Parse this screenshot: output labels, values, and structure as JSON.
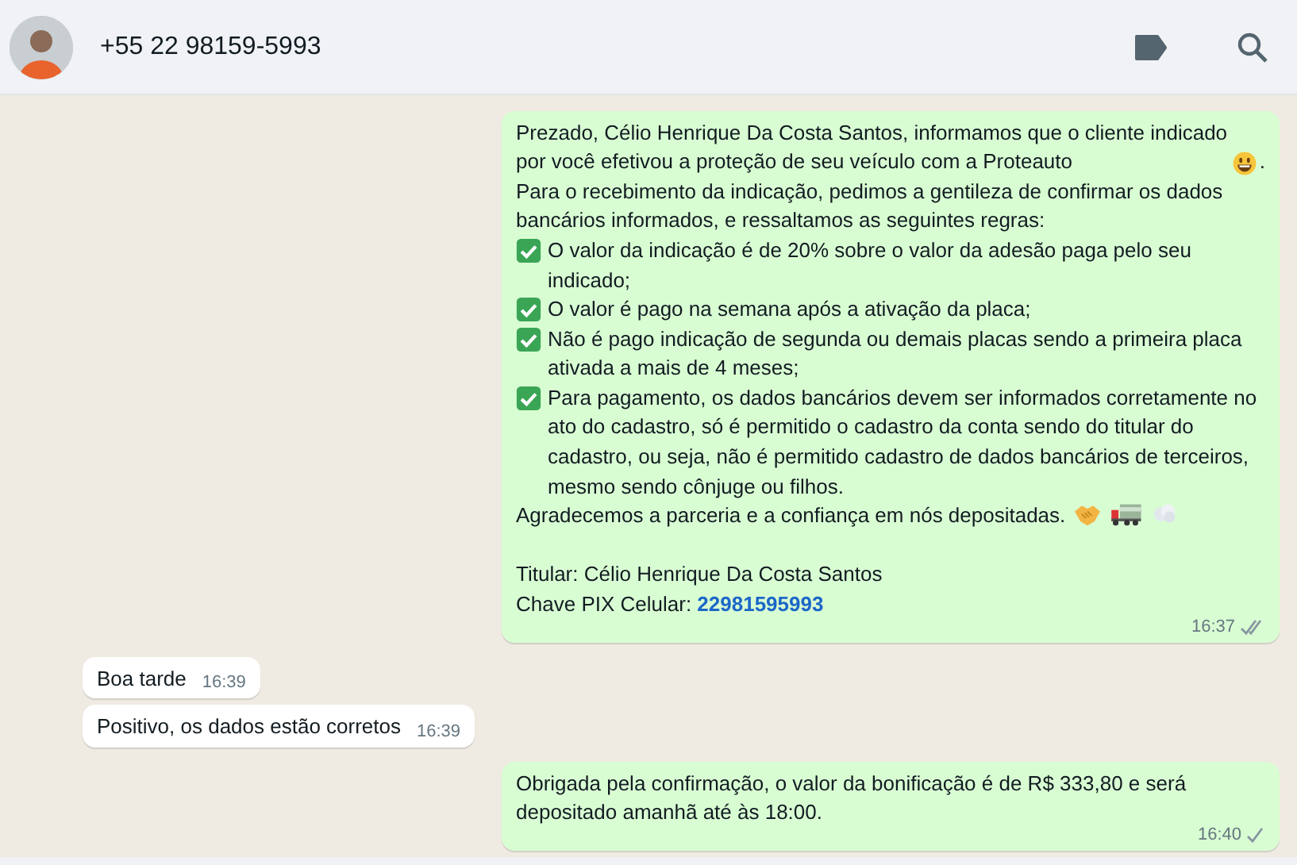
{
  "contact": {
    "name": "+55 22 98159-5993"
  },
  "messages": [
    {
      "kind": "out",
      "delivered": true,
      "time": "16:37",
      "paragraphs": [
        {
          "kind": "plain",
          "text": "Prezado, Célio Henrique Da Costa Santos, informamos que o cliente indicado por você efetivou a proteção de seu veículo com a Proteauto",
          "icons": [
            {
              "kind": "smiley"
            }
          ],
          "tail": "."
        },
        {
          "kind": "plain",
          "text": "Para o recebimento da indicação, pedimos a gentileza de confirmar os dados bancários informados, e  ressaltamos as seguintes regras:"
        },
        {
          "kind": "check",
          "text": "O valor da indicação é de 20% sobre o valor da adesão paga pelo seu indicado;"
        },
        {
          "kind": "check",
          "text": "O valor é pago na semana após a ativação da placa;"
        },
        {
          "kind": "check",
          "text": "Não é pago indicação de segunda ou demais placas sendo a primeira placa ativada a mais de 4 meses;"
        },
        {
          "kind": "check",
          "text": "Para pagamento, os dados bancários devem ser informados corretamente no ato do cadastro, só é permitido o cadastro da conta sendo do titular do cadastro, ou seja, não é permitido cadastro de dados bancários de terceiros, mesmo sendo cônjuge ou filhos."
        },
        {
          "kind": "plain",
          "text": "Agradecemos a parceria e a confiança em nós depositadas.",
          "icons": [
            {
              "kind": "handshake"
            },
            {
              "kind": "truck"
            },
            {
              "kind": "dash"
            }
          ]
        },
        {
          "kind": "blank"
        },
        {
          "kind": "plain",
          "text": "Titular: Célio Henrique Da Costa Santos"
        },
        {
          "kind": "link",
          "text": "Chave PIX Celular:",
          "link": "22981595993"
        }
      ]
    },
    {
      "kind": "in",
      "time": "16:39",
      "paragraphs": [
        {
          "kind": "plain",
          "text": "Boa tarde"
        }
      ]
    },
    {
      "kind": "in",
      "time": "16:39",
      "paragraphs": [
        {
          "kind": "plain",
          "text": "Positivo, os dados estão corretos"
        }
      ]
    },
    {
      "kind": "out",
      "delivered": false,
      "time": "16:40",
      "paragraphs": [
        {
          "kind": "plain",
          "text": "Obrigada pela confirmação, o valor da bonificação é de R$ 333,80 e será depositado amanhã até às 18:00."
        }
      ]
    }
  ]
}
